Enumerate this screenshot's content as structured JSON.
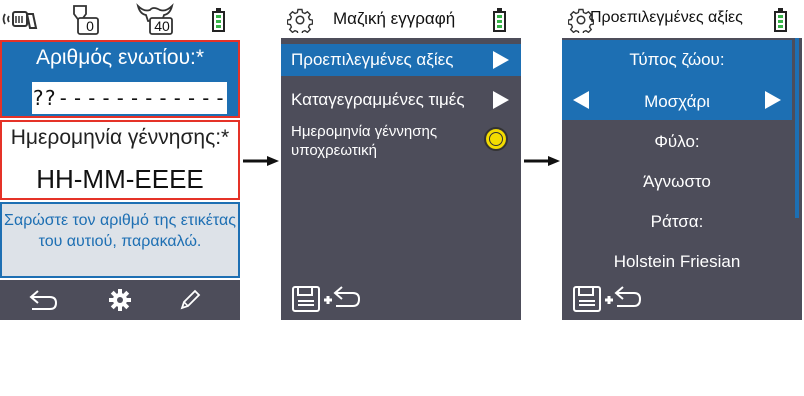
{
  "screen1": {
    "eartag_label": "Αριθμός ενωτίου:*",
    "eartag_cells": [
      "??",
      "-",
      "-",
      "-",
      "-",
      "-",
      "-",
      "-",
      "-",
      "-",
      "-",
      "-",
      "-"
    ],
    "dob_label": "Ημερομηνία γέννησης:*",
    "dob_value": "ΗΗ-ΜΜ-ΕΕΕΕ",
    "message": "Σαρώστε τον αριθμό της ετικέτας του αυτιού, παρακαλώ.",
    "status_counter_1": "0",
    "status_counter_2": "40",
    "icons": [
      "scanner-icon",
      "animal-count-icon",
      "cow-count-icon",
      "battery-icon",
      "back-icon",
      "gear-icon",
      "pencil-icon"
    ]
  },
  "screen2": {
    "title": "Μαζική εγγραφή",
    "items": [
      {
        "label": "Προεπιλεγμένες αξίες"
      },
      {
        "label": "Καταγεγραμμένες τιμές"
      },
      {
        "label": "Ημερομηνία γέννησης υποχρεωτική"
      }
    ],
    "icons": [
      "gear-icon",
      "battery-icon",
      "save-back-icon"
    ]
  },
  "screen3": {
    "title": "Προεπιλεγμένες αξίες",
    "animal_type_label": "Τύπος ζώου:",
    "animal_type_value": "Μοσχάρι",
    "sex_label": "Φύλο:",
    "sex_value": "Άγνωστο",
    "breed_label": "Ράτσα:",
    "breed_value": "Holstein Friesian",
    "icons": [
      "gear-icon",
      "battery-icon",
      "save-back-icon"
    ]
  },
  "colors": {
    "accent_blue": "#1d6fb3",
    "panel_gray": "#4d4d5a",
    "error_red": "#e53228",
    "battery_green": "#39b54a",
    "radio_yellow": "#f3dc00"
  }
}
